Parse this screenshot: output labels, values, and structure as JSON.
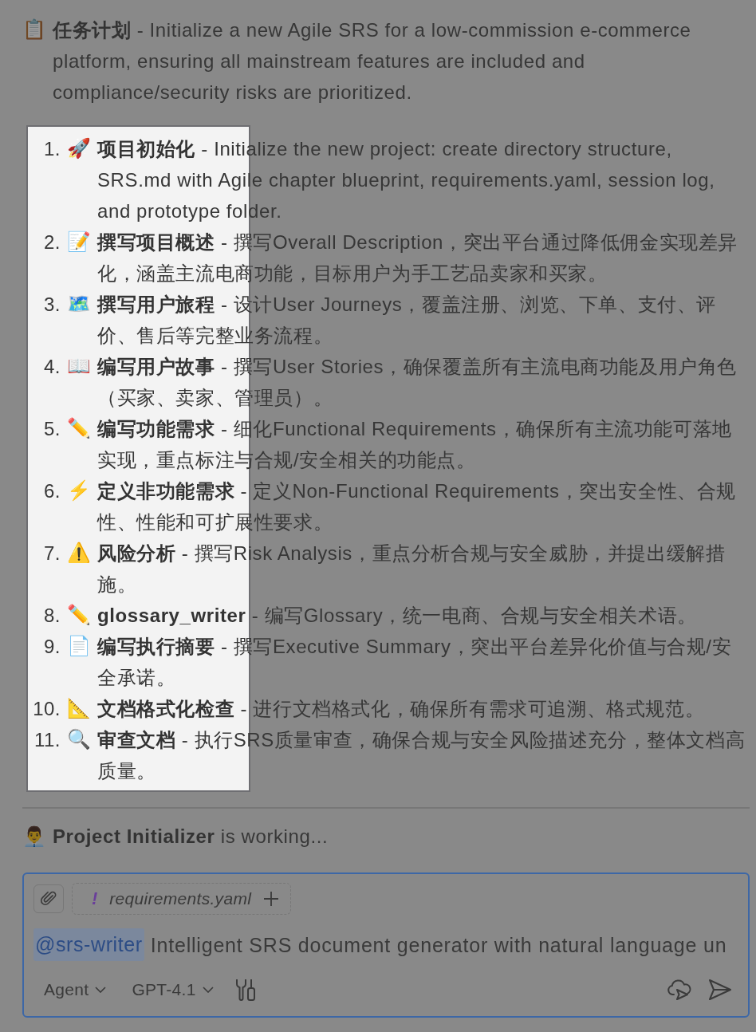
{
  "plan": {
    "emoji": "📋",
    "text": "**任务计划** - Initialize a new Agile SRS for a low-commission e-commerce platform, ensuring all mainstream features are included and compliance/security risks are prioritized."
  },
  "steps": [
    {
      "number": "1.",
      "emoji": "🚀",
      "text": "**项目初始化** - Initialize the new project: create directory structure, SRS.md with Agile chapter blueprint, requirements.yaml, session log, and prototype folder."
    },
    {
      "number": "2.",
      "emoji": "📝",
      "text": "**撰写项目概述** - 撰写Overall Description，突出平台通过降低佣金实现差异化，涵盖主流电商功能，目标用户为手工艺品卖家和买家。"
    },
    {
      "number": "3.",
      "emoji": "🗺️",
      "text": "**撰写用户旅程** - 设计User Journeys，覆盖注册、浏览、下单、支付、评价、售后等完整业务流程。"
    },
    {
      "number": "4.",
      "emoji": "📖",
      "text": "**编写用户故事** - 撰写User Stories，确保覆盖所有主流电商功能及用户角色（买家、卖家、管理员）。"
    },
    {
      "number": "5.",
      "emoji": "✏️",
      "text": "**编写功能需求** - 细化Functional Requirements，确保所有主流功能可落地实现，重点标注与合规/安全相关的功能点。"
    },
    {
      "number": "6.",
      "emoji": "⚡",
      "text": "**定义非功能需求** - 定义Non-Functional Requirements，突出安全性、合规性、性能和可扩展性要求。"
    },
    {
      "number": "7.",
      "emoji": "⚠️",
      "text": "**风险分析** - 撰写Risk Analysis，重点分析合规与安全威胁，并提出缓解措施。"
    },
    {
      "number": "8.",
      "emoji": "✏️",
      "text": "**glossary_writer** - 编写Glossary，统一电商、合规与安全相关术语。"
    },
    {
      "number": "9.",
      "emoji": "📄",
      "text": "**编写执行摘要** - 撰写Executive Summary，突出平台差异化价值与合规/安全承诺。"
    },
    {
      "number": "10.",
      "emoji": "📐",
      "text": "**文档格式化检查** - 进行文档格式化，确保所有需求可追溯、格式规范。"
    },
    {
      "number": "11.",
      "emoji": "🔍",
      "text": "**审查文档** - 执行SRS质量审查，确保合规与安全风险描述充分，整体文档高质量。"
    }
  ],
  "status": {
    "emoji": "👨‍💼",
    "text": "**Project Initializer** is working..."
  },
  "composer": {
    "context": {
      "badge": "!",
      "label": "requirements.yaml"
    },
    "mention": "@srs-writer",
    "value": "Intelligent SRS document generator with natural language un",
    "mode": "Agent",
    "model": "GPT-4.1"
  }
}
